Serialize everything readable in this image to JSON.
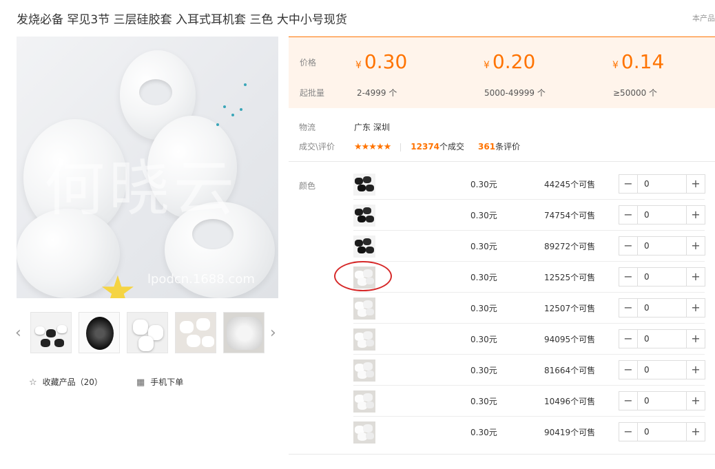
{
  "title": "发烧必备 罕见3节 三层硅胶套 入耳式耳机套 三色 大中小号现货",
  "corner_note": "本产品",
  "gallery": {
    "watermark": "何晓云",
    "watermark_url": "lpodcn.1688.com",
    "prev_icon": "chevron-left-icon",
    "next_icon": "chevron-right-icon"
  },
  "actions": {
    "favorite_label": "收藏产品（20）",
    "mobile_label": "手机下单"
  },
  "price_box": {
    "price_label": "价格",
    "qty_label": "起批量",
    "currency": "¥",
    "tiers": [
      {
        "price": "0.30",
        "qty": "2-4999 个"
      },
      {
        "price": "0.20",
        "qty": "5000-49999 个"
      },
      {
        "price": "0.14",
        "qty": "≥50000 个"
      }
    ]
  },
  "logistics": {
    "label": "物流",
    "value": "广东 深圳"
  },
  "reviews": {
    "label": "成交\\评价",
    "stars": "★★★★★",
    "rating": 4.5,
    "deals_num": "12374",
    "deals_suffix": "个成交",
    "reviews_num": "361",
    "reviews_suffix": "条评价"
  },
  "sku": {
    "label": "颜色",
    "rows": [
      {
        "price": "0.30元",
        "stock": "44245个可售",
        "qty": "0",
        "swatch": "black"
      },
      {
        "price": "0.30元",
        "stock": "74754个可售",
        "qty": "0",
        "swatch": "black"
      },
      {
        "price": "0.30元",
        "stock": "89272个可售",
        "qty": "0",
        "swatch": "black"
      },
      {
        "price": "0.30元",
        "stock": "12525个可售",
        "qty": "0",
        "swatch": "white"
      },
      {
        "price": "0.30元",
        "stock": "12507个可售",
        "qty": "0",
        "swatch": "white"
      },
      {
        "price": "0.30元",
        "stock": "94095个可售",
        "qty": "0",
        "swatch": "white"
      },
      {
        "price": "0.30元",
        "stock": "81664个可售",
        "qty": "0",
        "swatch": "white"
      },
      {
        "price": "0.30元",
        "stock": "10496个可售",
        "qty": "0",
        "swatch": "white"
      },
      {
        "price": "0.30元",
        "stock": "90419个可售",
        "qty": "0",
        "swatch": "white"
      }
    ],
    "minus": "−",
    "plus": "+"
  },
  "colors": {
    "accent": "#ff7300",
    "price_bg": "#fff4eb",
    "circle": "#d62828"
  }
}
